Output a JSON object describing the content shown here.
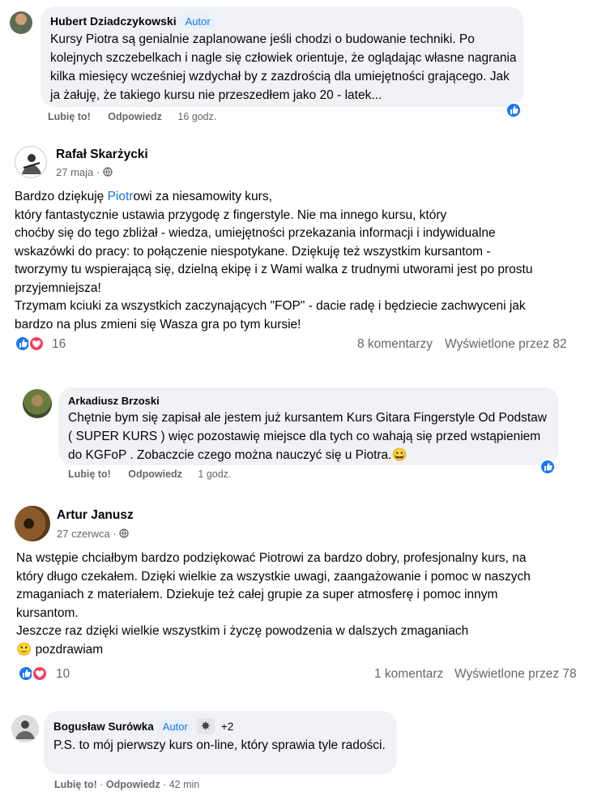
{
  "comment1": {
    "author": "Hubert Dziadczykowski",
    "badge": "Autor",
    "text": "Kursy Piotra są genialnie zaplanowane jeśli chodzi o budowanie techniki. Po kolejnych szczebelkach i nagle się człowiek orientuje, że oglądając własne nagrania kilka miesięcy wcześniej wzdychał by z zazdrością dla umiejętności grającego. Jak ja żałuję, że takiego kursu nie przeszedłem jako 20 - latek...",
    "like": "Lubię to!",
    "reply": "Odpowiedz",
    "time": "16 godz."
  },
  "post1": {
    "author": "Rafał Skarżycki",
    "date": "27 maja",
    "dot": "·",
    "text_prefix": "Bardzo dziękuję ",
    "text_link": "Piotr",
    "text_rest": "owi za niesamowity kurs,\nktóry fantastycznie ustawia przygodę z fingerstyle. Nie ma innego kursu, który\nchoćby się do tego zbliżał - wiedza, umiejętności przekazania informacji i indywidualne\nwskazówki do pracy: to połączenie niespotykane. Dziękuję też wszystkim kursantom -\ntworzymy tu wspierającą się, dzielną ekipę i z Wami walka z trudnymi utworami jest po prostu\nprzyjemniejsza!\nTrzymam kciuki za wszystkich zaczynających \"FOP\" - dacie radę i będziecie zachwyceni jak\nbardzo na plus zmieni się Wasza gra po tym kursie!",
    "reactions": "16",
    "comments": "8 komentarzy",
    "views": "Wyświetlone przez 82"
  },
  "comment2": {
    "author": "Arkadiusz Brzoski",
    "text": "Chętnie bym się zapisał ale jestem już kursantem Kurs Gitara Fingerstyle Od Podstaw ( SUPER KURS ) więc pozostawię miejsce dla tych co wahają się przed wstąpieniem do KGFoP . Zobaczcie czego można nauczyć się u Piotra.",
    "emoji": "😀",
    "like": "Lubię to!",
    "reply": "Odpowiedz",
    "time": "1 godz."
  },
  "post2": {
    "author": "Artur Janusz",
    "date": "27 czerwca",
    "dot": "·",
    "text": "Na wstępie chciałbym bardzo podziękować Piotrowi za bardzo dobry, profesjonalny kurs, na\nktóry długo czekałem. Dzięki wielkie za wszystkie uwagi, zaangażowanie i pomoc w naszych\nzmaganiach z materiałem. Dziekuje też całej grupie za super atmosferę i pomoc innym\nkursantom.\nJeszcze raz dzięki wielkie wszystkim i życzę powodzenia w dalszych zmaganiach",
    "emoji": "🙂",
    "last": "pozdrawiam",
    "reactions": "10",
    "comments": "1 komentarz",
    "views": "Wyświetlone przez 78"
  },
  "comment3": {
    "author": "Bogusław Surówka",
    "badge": "Autor",
    "extra_badges": "+2",
    "text": "P.S. to mój pierwszy kurs on-line, który sprawia tyle radości.",
    "like": "Lubię to!",
    "reply": "Odpowiedz",
    "time": "42 min",
    "dot": "·"
  },
  "colors": {
    "accent": "#1877f2",
    "love": "#f33e58",
    "bubble": "#f0f2f5",
    "muted": "#65676b"
  }
}
